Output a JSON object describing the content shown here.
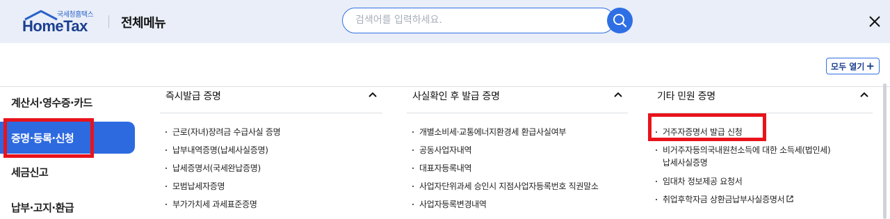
{
  "header": {
    "logo_sub": "국세청홈택스",
    "logo_main": "HomeTax",
    "title": "전체메뉴",
    "search_placeholder": "검색어를 입력하세요.",
    "search_icon": "search-icon",
    "close_icon": "close-icon"
  },
  "open_all": {
    "label": "모두 열기",
    "icon": "plus-icon"
  },
  "nav": {
    "items": [
      {
        "label": "계산서·영수증·카드"
      },
      {
        "label": "증명·등록·신청",
        "active": true
      },
      {
        "label": "세금신고"
      },
      {
        "label": "납부·고지·환급"
      }
    ]
  },
  "columns": [
    {
      "title": "즉시발급 증명",
      "items": [
        "근로(자녀)장려금 수급사실 증명",
        "납부내역증명(납세사실증명)",
        "납세증명서(국세완납증명)",
        "모범납세자증명",
        "부가가치세 과세표준증명"
      ]
    },
    {
      "title": "사실확인 후 발급 증명",
      "items": [
        "개별소비세·교통에너지환경세 환급사실여부",
        "공동사업자내역",
        "대표자등록내역",
        "사업자단위과세 승인시 지점사업자등록번호 직권말소",
        "사업자등록변경내역"
      ]
    },
    {
      "title": "기타 민원 증명",
      "items": [
        "거주자증명서 발급 신청",
        "비거주자등의국내원천소득에 대한 소득세(법인세)",
        "납세사실증명",
        "임대차 정보제공 요청서",
        "취업후학자금 상환금납부사실증명서"
      ]
    }
  ],
  "colors": {
    "accent": "#2f6fe4",
    "nav_active_bg": "#2d6ae0",
    "highlight": "#e8131b",
    "header_bg": "#e9eef8"
  }
}
